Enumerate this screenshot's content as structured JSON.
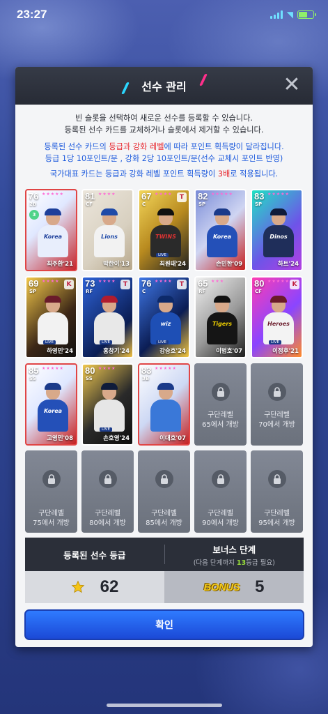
{
  "status_bar": {
    "time": "23:27"
  },
  "modal": {
    "title": "선수 관리",
    "description": {
      "line1": "빈 슬롯을 선택하여 새로운 선수를 등록할 수 있습니다.",
      "line2": "등록된 선수 카드를 교체하거나 슬롯에서 제거할 수 있습니다.",
      "line3_a": "등록된 선수 카드의 ",
      "line3_b": "등급과 강화 레벨",
      "line3_c": "에 따라 포인트 획득량이 달라집니다.",
      "line4": "등급 1당 10포인트/분 , 강화 2당 10포인트/분(선수 교체시 포인트 반영)",
      "line5_a": "국가대표 카드는 등급과 강화 레벨 포인트 획득량이 ",
      "line5_b": "3배",
      "line5_c": "로 적용됩니다."
    },
    "cards": [
      {
        "rating": "76",
        "pos": "2B",
        "stars": "★★★★★",
        "name": "최주환'21",
        "badge": ""
      },
      {
        "rating": "81",
        "pos": "CF",
        "stars": "★★★★",
        "name": "박한이'13",
        "badge": ""
      },
      {
        "rating": "67",
        "pos": "C",
        "stars": "★★★★",
        "name": "최원태'24",
        "badge": ""
      },
      {
        "rating": "82",
        "pos": "SP",
        "stars": "★★★★★",
        "name": "손민한'09",
        "badge": ""
      },
      {
        "rating": "83",
        "pos": "SP",
        "stars": "★★★★★",
        "name": "하트'24",
        "badge": ""
      },
      {
        "rating": "69",
        "pos": "SP",
        "stars": "★★★★",
        "name": "하영민'24",
        "badge": "K"
      },
      {
        "rating": "73",
        "pos": "RF",
        "stars": "★★★★",
        "name": "홍창기'24",
        "badge": "T"
      },
      {
        "rating": "76",
        "pos": "C",
        "stars": "★★★★",
        "name": "강승호'24",
        "badge": "T"
      },
      {
        "rating": "65",
        "pos": "RF",
        "stars": "★★★",
        "name": "이범호'07",
        "badge": ""
      },
      {
        "rating": "80",
        "pos": "CF",
        "stars": "★★★★★",
        "name": "이정후'21",
        "badge": "K"
      },
      {
        "rating": "85",
        "pos": "SS",
        "stars": "★★★★★",
        "name": "고영민'08",
        "badge": ""
      },
      {
        "rating": "80",
        "pos": "SS",
        "stars": "★★★★",
        "name": "손호영'24",
        "badge": ""
      },
      {
        "rating": "83",
        "pos": "3B",
        "stars": "★★★★★",
        "name": "이대호'07",
        "badge": ""
      }
    ],
    "locked_slots": [
      {
        "line1": "구단레벨",
        "line2": "65에서 개방"
      },
      {
        "line1": "구단레벨",
        "line2": "70에서 개방"
      },
      {
        "line1": "구단레벨",
        "line2": "75에서 개방"
      },
      {
        "line1": "구단레벨",
        "line2": "80에서 개방"
      },
      {
        "line1": "구단레벨",
        "line2": "85에서 개방"
      },
      {
        "line1": "구단레벨",
        "line2": "90에서 개방"
      },
      {
        "line1": "구단레벨",
        "line2": "95에서 개방"
      }
    ],
    "info": {
      "registered_grade_label": "등록된 선수 등급",
      "bonus_stage_label": "보너스 단계",
      "bonus_sub_a": "(다음 단계까지 ",
      "bonus_sub_num": "13",
      "bonus_sub_b": "등급 필요)",
      "grade_value": "62",
      "bonus_logo_text": "BONUS",
      "bonus_value": "5"
    },
    "confirm_label": "확인",
    "close_icon": "close-icon"
  },
  "colors": {
    "confirm_button": "#2f7bff",
    "grade_highlight": "#e8282f",
    "info_blue": "#1e5bdd",
    "bonus_number": "#9adf3b"
  }
}
